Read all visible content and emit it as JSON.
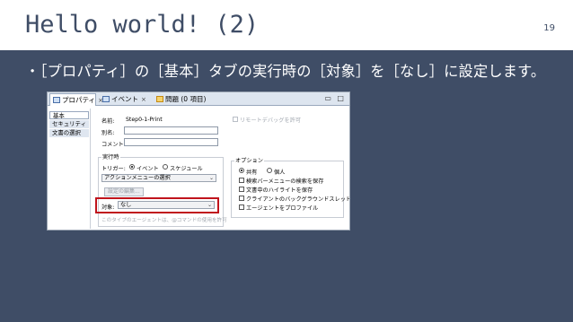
{
  "slide": {
    "title": "Hello world! (2)",
    "page_number": "19",
    "bullet": "・［プロパティ］の［基本］タブの実行時の［対象］を［なし］に設定します。"
  },
  "screenshot": {
    "tabs": [
      {
        "label": "プロパティ",
        "close": "×",
        "icon": "properties-icon"
      },
      {
        "label": "イベント",
        "close": "×",
        "icon": "events-icon"
      },
      {
        "label": "問題 (0 項目)",
        "close": "",
        "icon": "problems-icon"
      }
    ],
    "window_buttons": "▭ □",
    "sidebar": [
      {
        "label": "基本"
      },
      {
        "label": "セキュリティ"
      },
      {
        "label": "文書の選択"
      }
    ],
    "form": {
      "name_label": "名前:",
      "name_value": "Step0-1-Print",
      "remote_debug": "リモートデバッグを許可",
      "alias_label": "別名:",
      "comment_label": "コメント:",
      "runtime_group": "実行時",
      "trigger_label": "トリガー:",
      "trigger_event": "イベント",
      "trigger_schedule": "スケジュール",
      "action_menu_value": "アクションメニューの選択",
      "edit_button": "設定の編集...",
      "target_label": "対象:",
      "target_value": "なし",
      "note": "このタイプのエージェントは、@コマンドの使用を許可"
    },
    "options": {
      "title": "オプション",
      "shared": "共有",
      "personal": "個人",
      "checkboxes": [
        "検索バーメニューの検索を保存",
        "文書中のハイライトを保存",
        "クライアントのバックグラウンドスレッドで実行",
        "エージェントをプロファイル"
      ]
    }
  }
}
